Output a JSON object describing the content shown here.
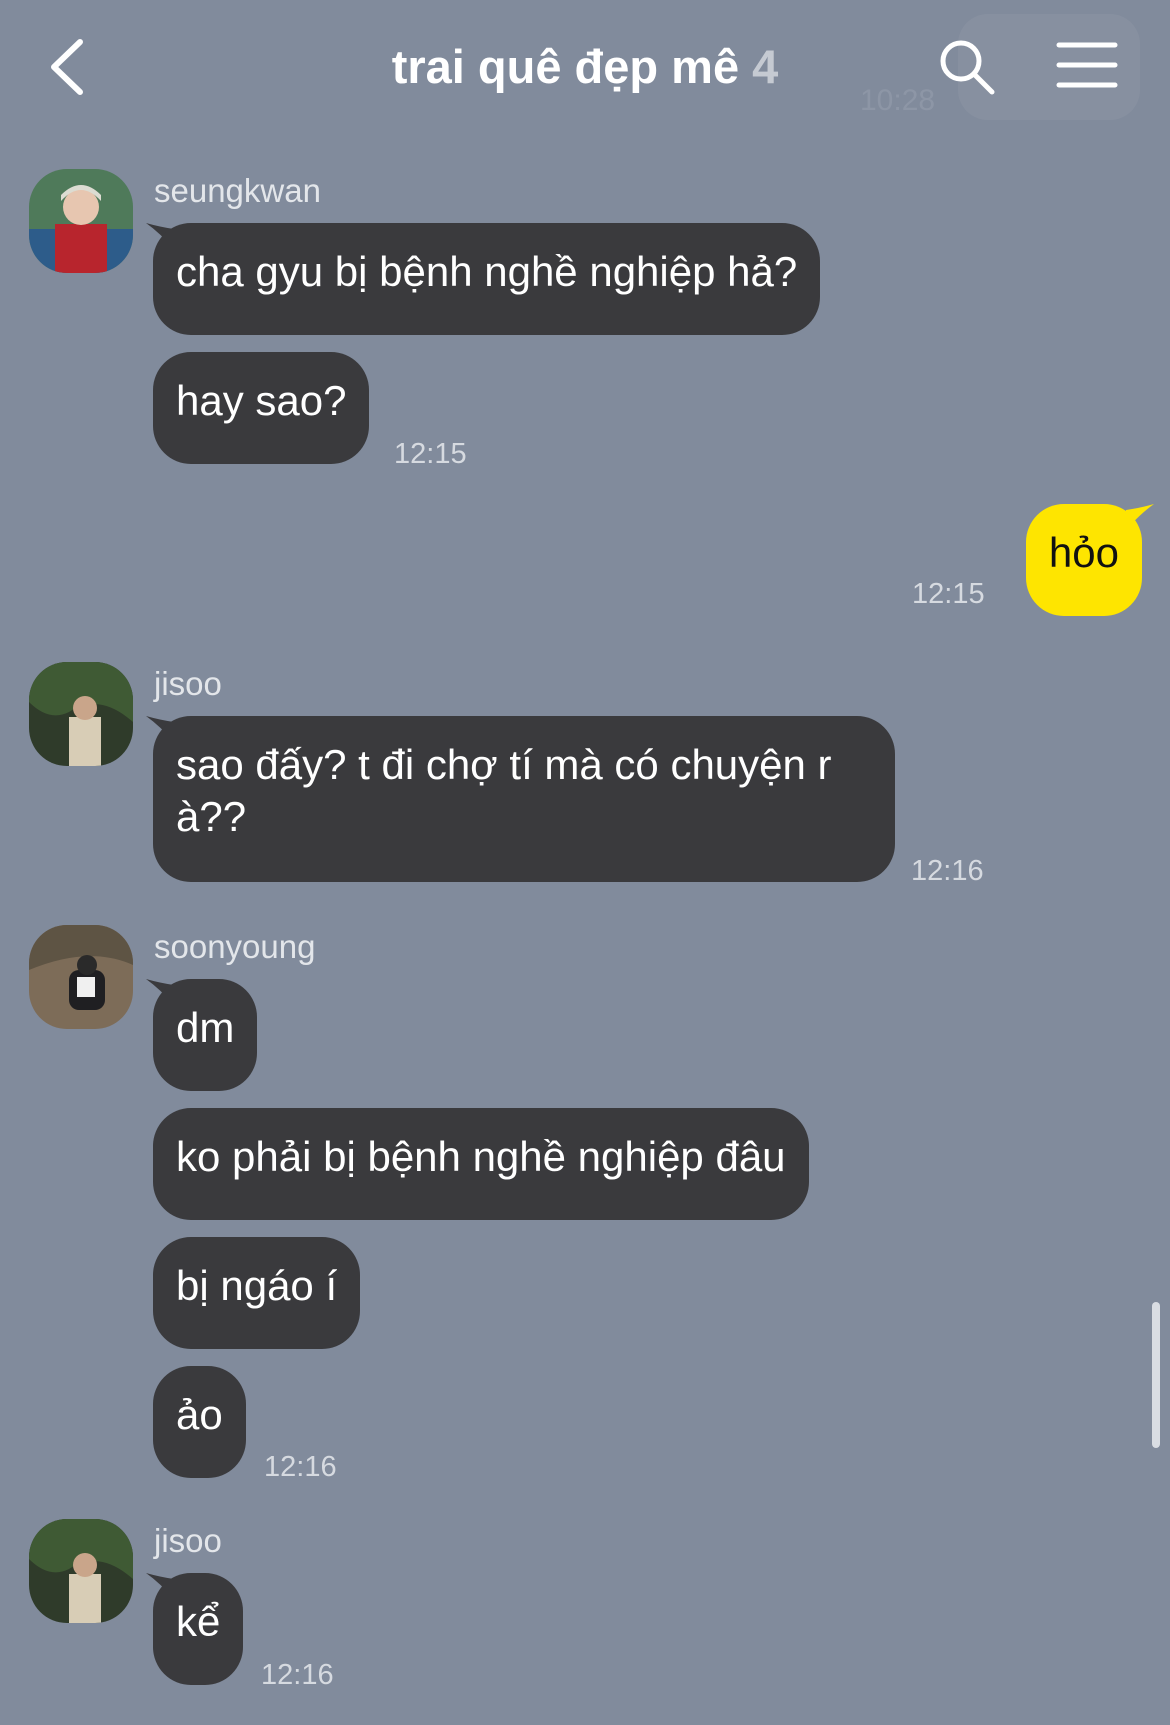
{
  "header": {
    "title": "trai quê đẹp mê",
    "member_count": "4",
    "ghost_time": "10:28"
  },
  "messages": [
    {
      "sender": "seungkwan",
      "bubbles": [
        "cha gyu bị bệnh nghề nghiệp hả?",
        "hay sao?"
      ],
      "time": "12:15"
    },
    {
      "sender": "me",
      "bubbles": [
        "hỏo"
      ],
      "time": "12:15"
    },
    {
      "sender": "jisoo",
      "bubbles": [
        "sao đấy? t đi chợ tí mà có chuyện r à??"
      ],
      "time": "12:16"
    },
    {
      "sender": "soonyoung",
      "bubbles": [
        "dm",
        "ko phải bị bệnh nghề nghiệp đâu",
        "bị ngáo í",
        "ảo"
      ],
      "time": "12:16"
    },
    {
      "sender": "jisoo",
      "bubbles": [
        "kể"
      ],
      "time": "12:16"
    }
  ],
  "colors": {
    "background": "#818b9c",
    "incoming_bubble": "#3a3a3d",
    "outgoing_bubble": "#fee500"
  },
  "icons": [
    "back-icon",
    "search-icon",
    "menu-icon"
  ]
}
